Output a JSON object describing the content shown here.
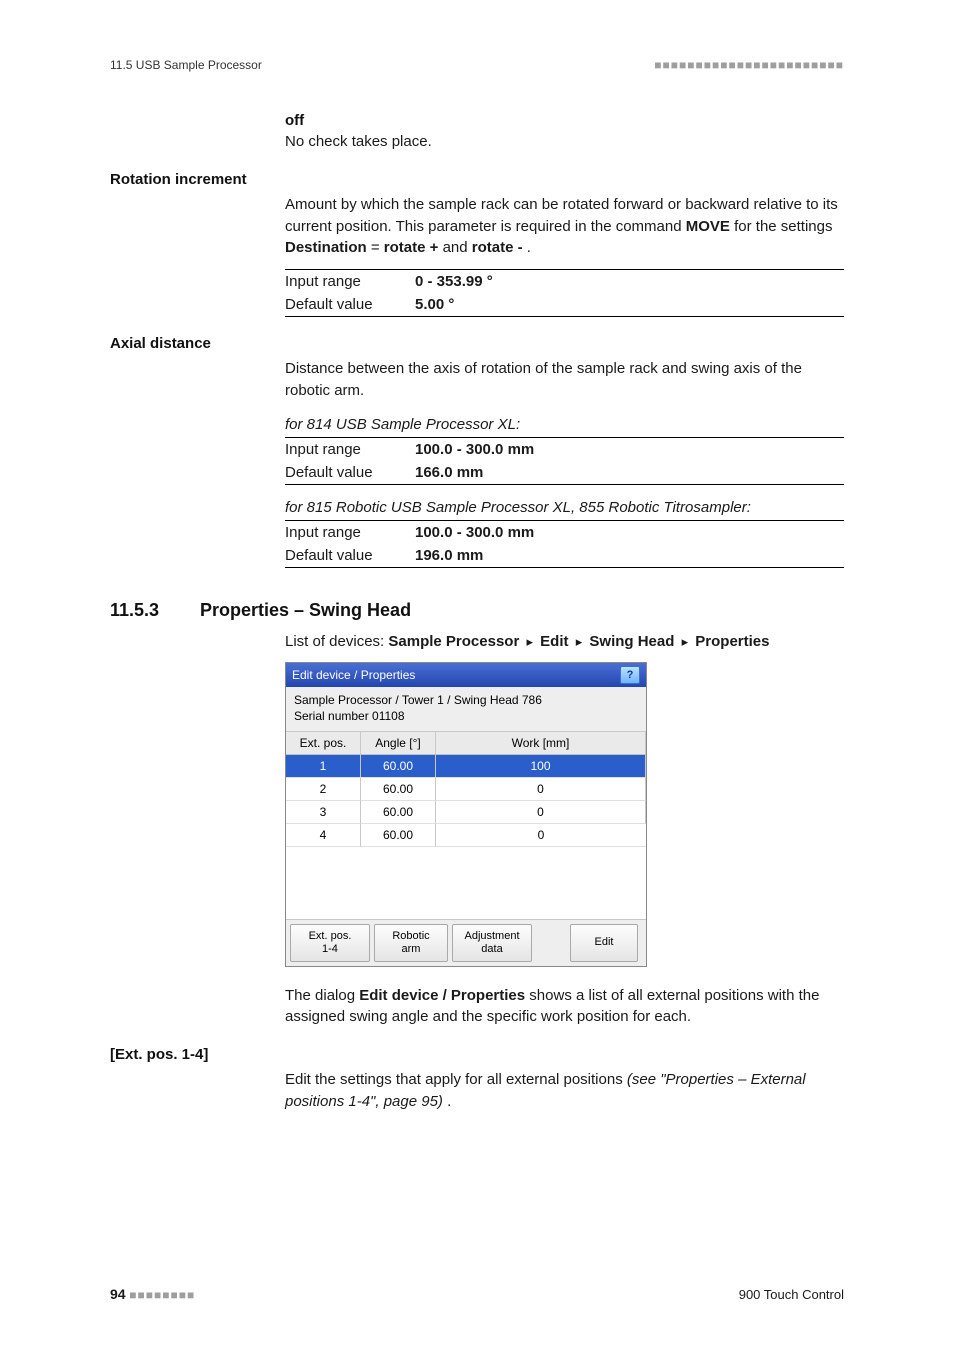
{
  "header": {
    "left": "11.5 USB Sample Processor",
    "right_squares": "■■■■■■■■■■■■■■■■■■■■■■■"
  },
  "off_block": {
    "term": "off",
    "text": "No check takes place."
  },
  "rotation": {
    "heading": "Rotation increment",
    "para_pre": "Amount by which the sample rack can be rotated forward or backward relative to its current position. This parameter is required in the command ",
    "move": "MOVE",
    "mid": " for the settings ",
    "dest": "Destination",
    "eq": " = ",
    "r_plus": "rotate +",
    "and": " and ",
    "r_minus": "rotate -",
    "tail": ".",
    "row1_label": "Input range",
    "row1_value": "0 - 353.99 °",
    "row2_label": "Default value",
    "row2_value": "5.00 °"
  },
  "axial": {
    "heading": "Axial distance",
    "para": "Distance between the axis of rotation of the sample rack and swing axis of the robotic arm.",
    "note1": "for 814 USB Sample Processor XL:",
    "t1_row1_label": "Input range",
    "t1_row1_value": "100.0 - 300.0 mm",
    "t1_row2_label": "Default value",
    "t1_row2_value": "166.0 mm",
    "note2": "for 815 Robotic USB Sample Processor XL, 855 Robotic Titrosampler:",
    "t2_row1_label": "Input range",
    "t2_row1_value": "100.0 - 300.0 mm",
    "t2_row2_label": "Default value",
    "t2_row2_value": "196.0 mm"
  },
  "section": {
    "number": "11.5.3",
    "title": "Properties – Swing Head",
    "breadcrumb_prefix": "List of devices: ",
    "bc1": "Sample Processor",
    "bc2": "Edit",
    "bc3": "Swing Head",
    "bc4": "Properties"
  },
  "dialog": {
    "title": "Edit device / Properties",
    "help": "?",
    "sub_line1": "Sample Processor / Tower 1 / Swing Head 786",
    "sub_line2": "Serial number 01108",
    "col1": "Ext. pos.",
    "col2": "Angle [°]",
    "col3": "Work [mm]",
    "rows": [
      {
        "p": "1",
        "a": "60.00",
        "w": "100"
      },
      {
        "p": "2",
        "a": "60.00",
        "w": "0"
      },
      {
        "p": "3",
        "a": "60.00",
        "w": "0"
      },
      {
        "p": "4",
        "a": "60.00",
        "w": "0"
      }
    ],
    "btn1": "Ext. pos.\n1-4",
    "btn2": "Robotic\narm",
    "btn3": "Adjustment\ndata",
    "btn4": "Edit"
  },
  "after_dialog": {
    "p_pre": "The dialog ",
    "p_bold": "Edit device / Properties",
    "p_post": " shows a list of all external positions with the assigned swing angle and the specific work position for each."
  },
  "extpos": {
    "heading": "[Ext. pos. 1-4]",
    "p_pre": "Edit the settings that apply for all external positions ",
    "p_ref": "(see \"Properties – External positions 1-4\", page 95)",
    "p_post": "."
  },
  "footer": {
    "page": "94",
    "squares": "■■■■■■■■",
    "right": "900 Touch Control"
  }
}
